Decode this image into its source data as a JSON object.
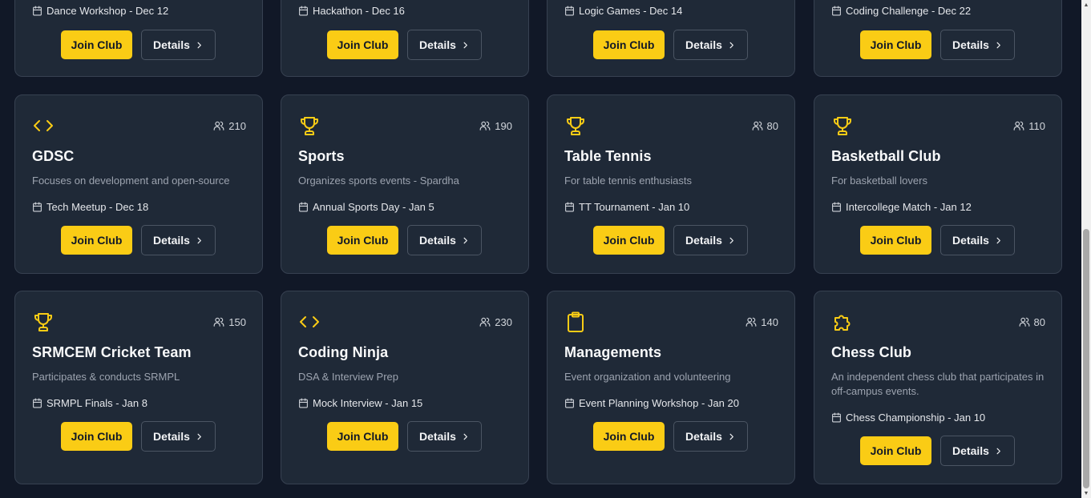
{
  "buttons": {
    "join_label": "Join Club",
    "details_label": "Details"
  },
  "clubs": [
    {
      "title": "",
      "description": "",
      "event": "Dance Workshop - Dec 12",
      "members": ""
    },
    {
      "title": "",
      "description": "",
      "event": "Hackathon - Dec 16",
      "members": ""
    },
    {
      "title": "",
      "description": "",
      "event": "Logic Games - Dec 14",
      "members": ""
    },
    {
      "title": "",
      "description": "",
      "event": "Coding Challenge - Dec 22",
      "members": ""
    },
    {
      "icon": "code-icon",
      "title": "GDSC",
      "description": "Focuses on development and open-source",
      "event": "Tech Meetup - Dec 18",
      "members": "210"
    },
    {
      "icon": "trophy-icon",
      "title": "Sports",
      "description": "Organizes sports events - Spardha",
      "event": "Annual Sports Day - Jan 5",
      "members": "190"
    },
    {
      "icon": "trophy-icon",
      "title": "Table Tennis",
      "description": "For table tennis enthusiasts",
      "event": "TT Tournament - Jan 10",
      "members": "80"
    },
    {
      "icon": "trophy-icon",
      "title": "Basketball Club",
      "description": "For basketball lovers",
      "event": "Intercollege Match - Jan 12",
      "members": "110"
    },
    {
      "icon": "trophy-icon",
      "title": "SRMCEM Cricket Team",
      "description": "Participates & conducts SRMPL",
      "event": "SRMPL Finals - Jan 8",
      "members": "150"
    },
    {
      "icon": "code-icon",
      "title": "Coding Ninja",
      "description": "DSA & Interview Prep",
      "event": "Mock Interview - Jan 15",
      "members": "230"
    },
    {
      "icon": "clipboard-icon",
      "title": "Managements",
      "description": "Event organization and volunteering",
      "event": "Event Planning Workshop - Jan 20",
      "members": "140"
    },
    {
      "icon": "puzzle-icon",
      "title": "Chess Club",
      "description": "An independent chess club that participates in off-campus events.",
      "event": "Chess Championship - Jan 10",
      "members": "80"
    }
  ],
  "colors": {
    "background": "#111827",
    "card": "#1f2937",
    "border": "#374151",
    "accent": "#facc15",
    "muted_text": "#9ca3af"
  }
}
